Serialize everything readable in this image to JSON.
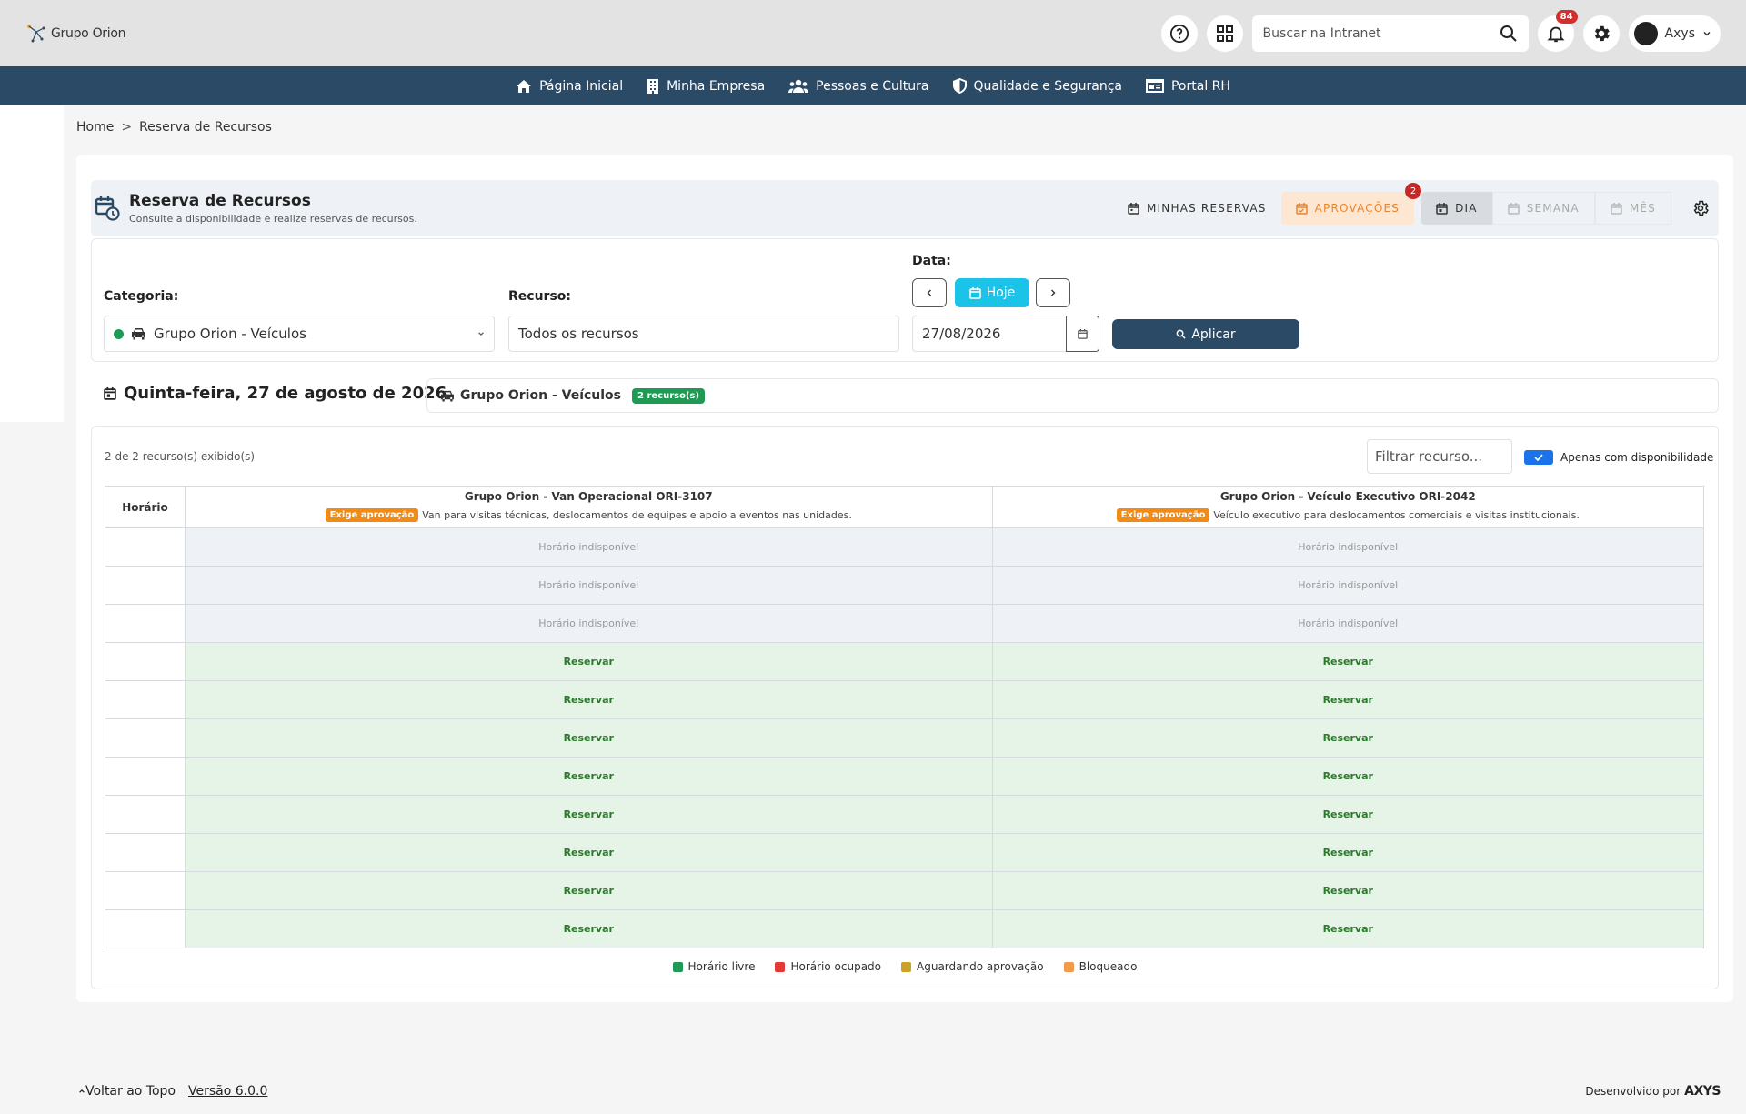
{
  "header": {
    "logo_text": "Grupo Orion",
    "search_placeholder": "Buscar na Intranet",
    "notifications_count": "84",
    "user_name": "Axys"
  },
  "nav": {
    "items": [
      {
        "label": "Página Inicial",
        "icon": "home-icon"
      },
      {
        "label": "Minha Empresa",
        "icon": "building-icon"
      },
      {
        "label": "Pessoas e Cultura",
        "icon": "users-icon"
      },
      {
        "label": "Qualidade e Segurança",
        "icon": "shield-icon"
      },
      {
        "label": "Portal RH",
        "icon": "id-card-icon"
      }
    ]
  },
  "breadcrumb": {
    "home": "Home",
    "sep": ">",
    "current": "Reserva de Recursos"
  },
  "page": {
    "title": "Reserva de Recursos",
    "subtitle": "Consulte a disponibilidade e realize reservas de recursos.",
    "actions": {
      "my_reservations": "MINHAS RESERVAS",
      "approvals": "APROVAÇÕES",
      "approvals_badge": "2",
      "day": "DIA",
      "week": "SEMANA",
      "month": "MÊS"
    }
  },
  "filters": {
    "category_label": "Categoria:",
    "category_value": "Grupo Orion - Veículos",
    "resource_label": "Recurso:",
    "resource_value": "Todos os recursos",
    "date_label": "Data:",
    "today_label": "Hoje",
    "date_value": "27/08/2026",
    "apply_label": "Aplicar"
  },
  "schedule": {
    "date_heading": "Quinta-feira, 27 de agosto de 2026",
    "category_chip": "Grupo Orion - Veículos",
    "resource_count_badge": "2 recurso(s)",
    "shown_text": "2 de 2 recurso(s) exibido(s)",
    "filter_placeholder": "Filtrar recurso...",
    "only_available_label": "Apenas com disponibilidade",
    "hour_header": "Horário",
    "resources": [
      {
        "name": "Grupo Orion - Van Operacional ORI-3107",
        "badge": "Exige aprovação",
        "desc": "Van para visitas técnicas, deslocamentos de equipes e apoio a eventos nas unidades."
      },
      {
        "name": "Grupo Orion - Veículo Executivo ORI-2042",
        "badge": "Exige aprovação",
        "desc": "Veículo executivo para deslocamentos comerciais e visitas institucionais."
      }
    ],
    "unavailable_text": "Horário indisponível",
    "reserve_text": "Reservar",
    "rows": [
      "unavail",
      "unavail",
      "unavail",
      "free",
      "free",
      "free",
      "free",
      "free",
      "free",
      "free",
      "free"
    ]
  },
  "legend": [
    {
      "label": "Horário livre",
      "color": "#1e9a55"
    },
    {
      "label": "Horário ocupado",
      "color": "#e53935"
    },
    {
      "label": "Aguardando aprovação",
      "color": "#c9a227"
    },
    {
      "label": "Bloqueado",
      "color": "#f2994a"
    }
  ],
  "footer": {
    "back_to_top": "Voltar ao Topo",
    "version": "Versão 6.0.0",
    "developed_by": "Desenvolvido por",
    "brand": "AXYS"
  }
}
